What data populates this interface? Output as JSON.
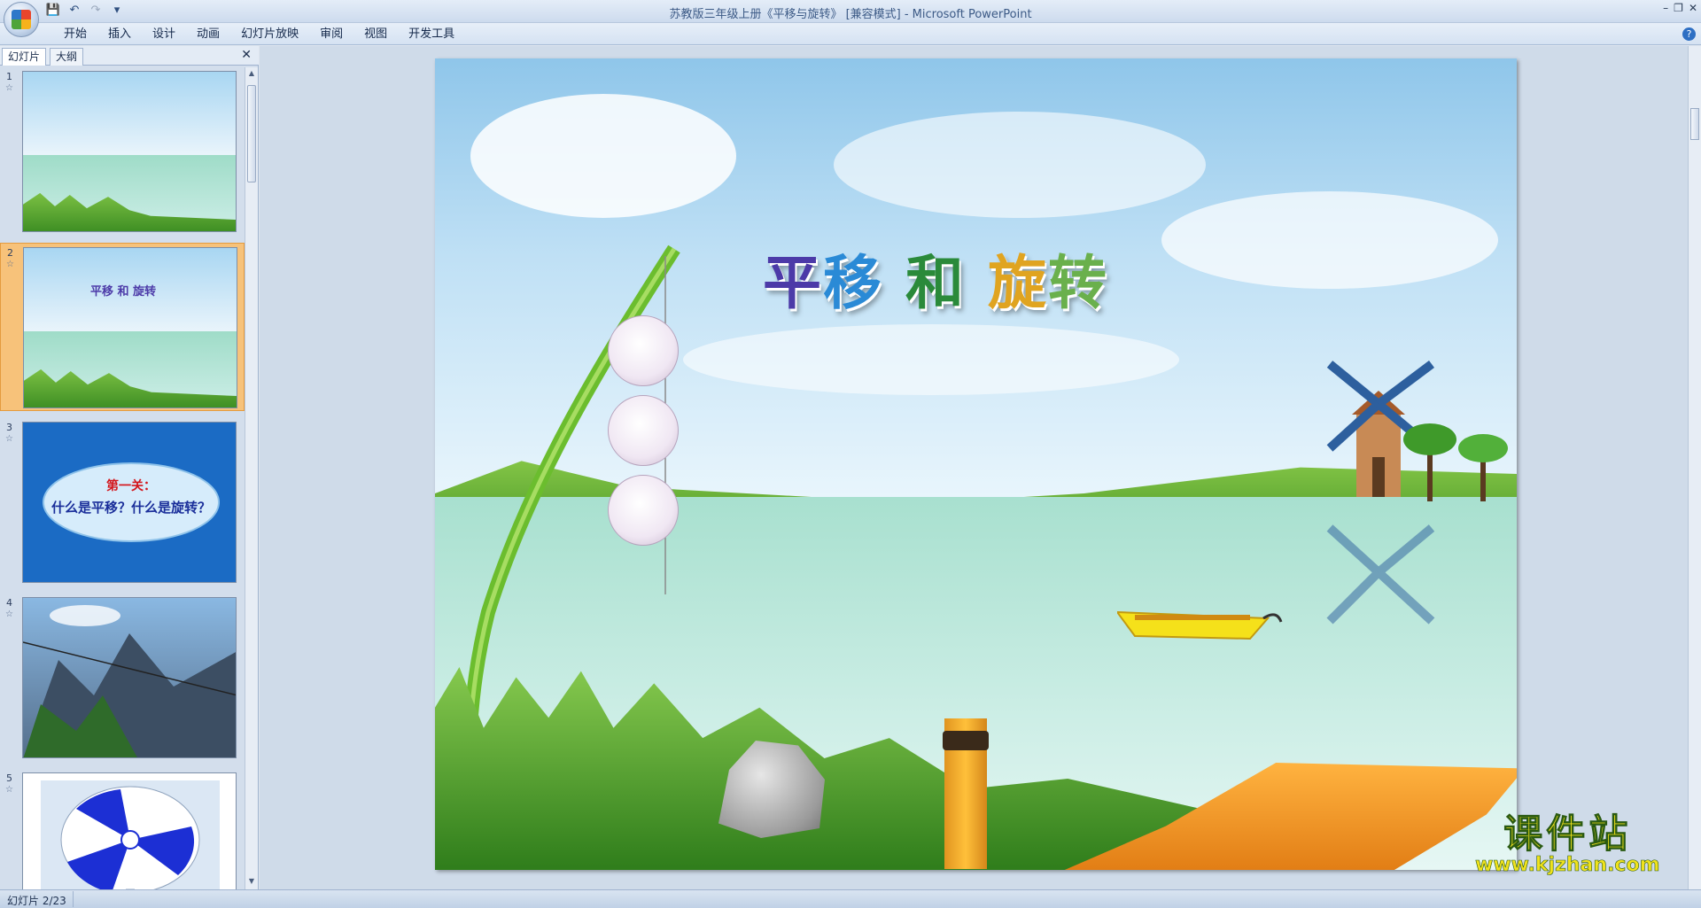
{
  "window": {
    "title": "苏教版三年级上册《平移与旋转》 [兼容模式] - Microsoft PowerPoint",
    "controls": [
      "–",
      "❐",
      "✕"
    ]
  },
  "quick_access": {
    "save_icon": "save-icon",
    "undo_icon": "undo-icon",
    "redo_icon": "redo-icon",
    "customize": "▾"
  },
  "ribbon": {
    "tabs": [
      "开始",
      "插入",
      "设计",
      "动画",
      "幻灯片放映",
      "审阅",
      "视图",
      "开发工具"
    ],
    "help": "?"
  },
  "left_pane": {
    "tab_slides": "幻灯片",
    "tab_outline": "大纲",
    "close": "✕",
    "thumbnails": [
      {
        "num": "1",
        "star": "☆"
      },
      {
        "num": "2",
        "star": "☆",
        "title": "平移 和 旋转"
      },
      {
        "num": "3",
        "star": "☆",
        "line1": "第一关：",
        "line2": "什么是平移？什么是旋转？"
      },
      {
        "num": "4",
        "star": "☆"
      },
      {
        "num": "5",
        "star": "☆"
      }
    ]
  },
  "slide": {
    "title_parts": [
      "平",
      "移",
      " 和 ",
      "旋",
      "转"
    ]
  },
  "watermark": {
    "brand": "课件站",
    "url": "www.kjzhan.com"
  },
  "status_bar": {
    "slide_info": "幻灯片 2/23"
  },
  "colors": {
    "selected_thumb": "#f7c27a",
    "title_purple": "#4c3aa8",
    "title_blue": "#2a8ad6",
    "title_green": "#2a8a3a",
    "title_gold": "#e0a420"
  }
}
